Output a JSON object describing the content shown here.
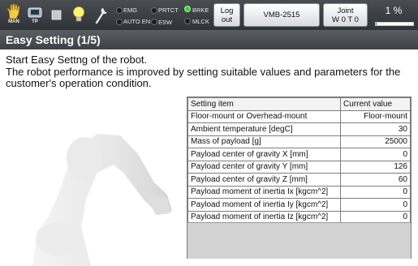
{
  "topbar": {
    "man_label": "MAN",
    "tp_label": "TP",
    "indicators": {
      "emg": "EMG",
      "auto_en": "AUTO EN",
      "prtct": "PRTCT",
      "esw": "ESW",
      "brke": "BRKE",
      "mlck": "MLCK"
    },
    "logout_line1": "Log",
    "logout_line2": "out",
    "robot_button": "VMB-2515",
    "joint_line1": "Joint",
    "joint_line2": "W 0 T 0",
    "speed_text": "1 %",
    "speed_fraction": 0.01,
    "accent_color": "#38d43a"
  },
  "page": {
    "title": "Easy Setting (1/5)",
    "description_line1": "Start Easy Settng of the robot.",
    "description_line2": "The robot performance is improved by setting suitable values and parameters for the",
    "description_line3": "customer's operation condition."
  },
  "table": {
    "headers": [
      "Setting item",
      "Current value"
    ],
    "rows": [
      {
        "item": "Floor-mount or Overhead-mount",
        "value": "Floor-mount"
      },
      {
        "item": "Ambient temperature [degC]",
        "value": "30"
      },
      {
        "item": "Mass of payload [g]",
        "value": "25000"
      },
      {
        "item": "Payload center of gravity X [mm]",
        "value": "0"
      },
      {
        "item": "Payload center of gravity Y [mm]",
        "value": "126"
      },
      {
        "item": "Payload center of gravity Z [mm]",
        "value": "60"
      },
      {
        "item": "Payload moment of inertia Ix [kgcm^2]",
        "value": "0"
      },
      {
        "item": "Payload moment of inertia Iy [kgcm^2]",
        "value": "0"
      },
      {
        "item": "Payload moment of inertia Iz [kgcm^2]",
        "value": "0"
      }
    ]
  },
  "icons": [
    "hand-icon",
    "teach-pendant-icon",
    "stop-square-icon",
    "lightbulb-icon",
    "wrench-icon",
    "robot-arm-image"
  ]
}
